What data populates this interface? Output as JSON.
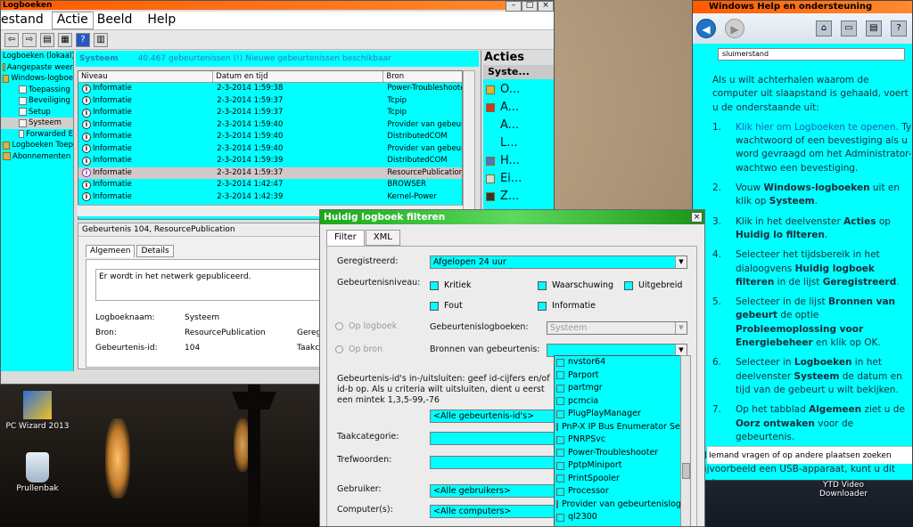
{
  "desktop": {
    "icons": [
      {
        "label": "PC Wizard 2013",
        "name": "pc-wizard-desktop-icon"
      },
      {
        "label": "Prullenbak",
        "name": "recycle-bin-desktop-icon"
      },
      {
        "label": "YTD Video Downloader",
        "name": "ytd-video-downloader-desktop-icon"
      }
    ]
  },
  "logwin": {
    "title": "Logboeken",
    "menu": [
      "estand",
      "Actie",
      "Beeld",
      "Help"
    ],
    "active_menu": "Actie",
    "tree": [
      {
        "label": "Logboeken (lokaal)",
        "indent": 0
      },
      {
        "label": "Aangepaste weer",
        "indent": 1
      },
      {
        "label": "Windows-logboe",
        "indent": 1
      },
      {
        "label": "Toepassing",
        "indent": 2
      },
      {
        "label": "Beveiliging",
        "indent": 2
      },
      {
        "label": "Setup",
        "indent": 2
      },
      {
        "label": "Systeem",
        "indent": 2,
        "selected": true
      },
      {
        "label": "Forwarded E",
        "indent": 2
      },
      {
        "label": "Logboeken Toep",
        "indent": 1
      },
      {
        "label": "Abonnementen",
        "indent": 1
      }
    ],
    "center_header": {
      "title": "Systeem",
      "message": "40.467 gebeurtenissen (!) Nieuwe gebeurtenissen beschikbaar"
    },
    "columns": [
      "Niveau",
      "Datum en tijd",
      "Bron"
    ],
    "rows": [
      {
        "level": "Informatie",
        "date": "2-3-2014 1:59:38",
        "source": "Power-Troubleshooter"
      },
      {
        "level": "Informatie",
        "date": "2-3-2014 1:59:37",
        "source": "Tcpip"
      },
      {
        "level": "Informatie",
        "date": "2-3-2014 1:59:37",
        "source": "Tcpip"
      },
      {
        "level": "Informatie",
        "date": "2-3-2014 1:59:40",
        "source": "Provider van gebeurt"
      },
      {
        "level": "Informatie",
        "date": "2-3-2014 1:59:40",
        "source": "DistributedCOM"
      },
      {
        "level": "Informatie",
        "date": "2-3-2014 1:59:40",
        "source": "Provider van gebeurt"
      },
      {
        "level": "Informatie",
        "date": "2-3-2014 1:59:39",
        "source": "DistributedCOM"
      },
      {
        "level": "Informatie",
        "date": "2-3-2014 1:59:37",
        "source": "ResourcePublication",
        "selected": true
      },
      {
        "level": "Informatie",
        "date": "2-3-2014 1:42:47",
        "source": "BROWSER"
      },
      {
        "level": "Informatie",
        "date": "2-3-2014 1:42:39",
        "source": "Kernel-Power"
      }
    ],
    "detail": {
      "title": "Gebeurtenis 104, ResourcePublication",
      "tabs": [
        "Algemeen",
        "Details"
      ],
      "description": "Er wordt in het netwerk gepubliceerd.",
      "log_name_label": "Logboeknaam:",
      "log_name_value": "Systeem",
      "source_label": "Bron:",
      "source_value": "ResourcePublication",
      "registered_label": "Geregis",
      "event_id_label": "Gebeurtenis-id:",
      "event_id_value": "104",
      "task_label": "Taakcat"
    },
    "actions": {
      "title": "Acties",
      "section": "Syste...",
      "items": [
        "O...",
        "A...",
        "A...",
        "L...",
        "H...",
        "Ei...",
        "Z..."
      ]
    }
  },
  "help": {
    "title": "Windows Help en ondersteuning",
    "search_value": "sluimerstand",
    "intro": "Als u wilt achterhalen waarom de computer uit slaapstand is gehaald, voert u de onderstaande uit:",
    "steps": [
      {
        "num": "1.",
        "link": "Klik hier om Logboeken te openen.",
        "text": " Ty wachtwoord of een bevestiging als u word gevraagd om het Administrator-wachtwo een bevestiging."
      },
      {
        "num": "2.",
        "pre": "Vouw ",
        "bold": "Windows-logboeken",
        "text": " uit en klik op ",
        "bold2": "Systeem",
        "post": "."
      },
      {
        "num": "3.",
        "pre": "Klik in het deelvenster ",
        "bold": "Acties",
        "text": " op ",
        "bold2": "Huidig lo filteren",
        "post": "."
      },
      {
        "num": "4.",
        "pre": "Selecteer het tijdsbereik in het dialoogvens ",
        "bold": "Huidig logboek filteren",
        "text": " in de lijst ",
        "bold2": "Geregistreerd",
        "post": "."
      },
      {
        "num": "5.",
        "pre": "Selecteer in de lijst ",
        "bold": "Bronnen van gebeurt",
        "text": " de optie ",
        "bold2": "Probleemoplossing voor Energiebeheer",
        "post": " en klik op OK."
      },
      {
        "num": "6.",
        "pre": "Selecteer in ",
        "bold": "Logboeken",
        "text": " in het deelvenster ",
        "bold2": "Systeem",
        "post": " de datum en tijd van de gebeurt u wilt bekijken."
      },
      {
        "num": "7.",
        "pre": "Op het tabblad ",
        "bold": "Algemeen",
        "text": " ziet u de ",
        "bold2": "Oorz ontwaken",
        "post": " voor de gebeurtenis."
      }
    ],
    "outro": "Als het probleem wordt veroorzaakt door een bijvoorbeeld een USB-apparaat, kunt u dit zod",
    "footer": "Iemand vragen of op andere plaatsen zoeken"
  },
  "filter": {
    "title": "Huidig logboek filteren",
    "tabs": [
      "Filter",
      "XML"
    ],
    "registered_label": "Geregistreerd:",
    "registered_value": "Afgelopen 24 uur",
    "level_label": "Gebeurtenisniveau:",
    "levels": [
      "Kritiek",
      "Waarschuwing",
      "Uitgebreid",
      "Fout",
      "Informatie"
    ],
    "radio_log": "Op logboek",
    "radio_source": "Op bron",
    "logs_label": "Gebeurtenislogboeken:",
    "logs_value": "Systeem",
    "sources_label": "Bronnen van gebeurtenis:",
    "id_help": "Gebeurtenis-id's in-/uitsluiten: geef id-cijfers en/of id-b op. Als u criteria wilt uitsluiten, dient u eerst een mintek 1,3,5-99,-76",
    "id_value": "<Alle gebeurtenis-id's>",
    "task_label": "Taakcategorie:",
    "keywords_label": "Trefwoorden:",
    "user_label": "Gebruiker:",
    "user_value": "<Alle gebruikers>",
    "computer_label": "Computer(s):",
    "computer_value": "<Alle computers>",
    "sources": [
      "nvstor64",
      "Parport",
      "partmgr",
      "pcmcia",
      "PlugPlayManager",
      "PnP-X IP Bus Enumerator Serv",
      "PNRPSvc",
      "Power-Troubleshooter",
      "PptpMiniport",
      "PrintSpooler",
      "Processor",
      "Provider van gebeurtenislogbo",
      "ql2300"
    ]
  }
}
